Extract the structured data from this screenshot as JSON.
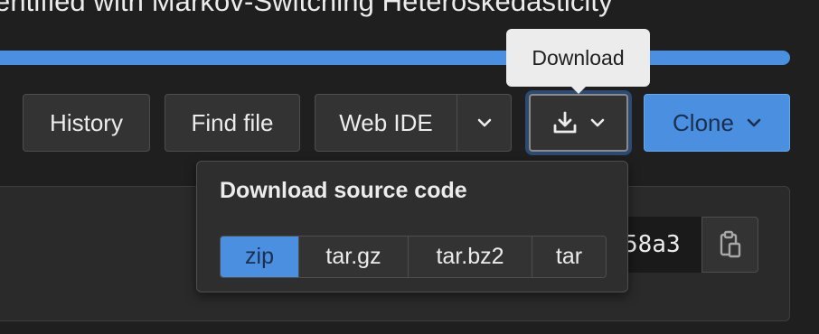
{
  "page": {
    "title": "entified with Markov-Switching Heteroskedasticity",
    "progress_percent": 100
  },
  "toolbar": {
    "history_label": "History",
    "find_file_label": "Find file",
    "web_ide_label": "Web IDE",
    "clone_label": "Clone"
  },
  "tooltip": {
    "text": "Download"
  },
  "download_dropdown": {
    "header": "Download source code",
    "formats": [
      "zip",
      "tar.gz",
      "tar.bz2",
      "tar"
    ],
    "selected": "zip"
  },
  "commit": {
    "sha_fragment": "58a3"
  },
  "icons": {
    "download": "download-icon",
    "chevron": "chevron-down-icon",
    "copy": "clipboard-icon"
  },
  "colors": {
    "background": "#1f1f1f",
    "accent": "#4a8fe0",
    "button": "#333333",
    "border": "#4e4e4e",
    "tooltip_bg": "#ececec",
    "text": "#ececec"
  }
}
